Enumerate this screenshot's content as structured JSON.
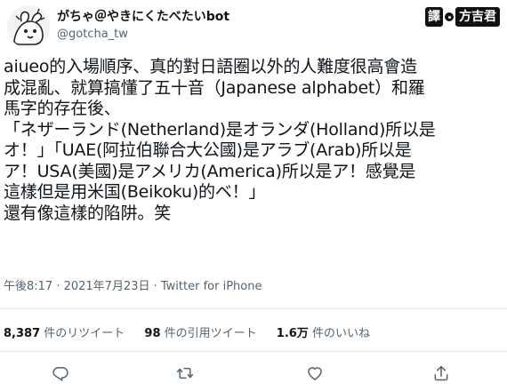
{
  "user": {
    "display_name": "がちゃ＠やきにくたべたいbot",
    "handle": "@gotcha_tw"
  },
  "watermark": {
    "mark": "譯",
    "name": "方吉君"
  },
  "tweet": {
    "lines": [
      "aiueo的入場順序、真的對日語圈以外的人難度很高會造",
      "成混亂、就算搞懂了五十音（Japanese alphabet）和羅",
      "馬字的存在後、",
      "「ネザーランド(Netherland)是オランダ(Holland)所以是",
      "オ！」「UAE(阿拉伯聯合大公國)是アラブ(Arab)所以是",
      "ア！USA(美國)是アメリカ(America)所以是ア！感覺是",
      "這樣但是用米国(Beikoku)的ベ！」",
      "還有像這樣的陷阱。笑"
    ],
    "timestamp": "午後8:17 · 2021年7月23日 · Twitter for iPhone"
  },
  "stats": {
    "retweets_value": "8,387",
    "retweets_label": " 件のリツイート",
    "quotes_value": "98",
    "quotes_label": " 件の引用ツイート",
    "likes_value": "1.6万",
    "likes_label": " 件のいいね"
  },
  "icons": {
    "reply": "reply-icon",
    "retweet": "retweet-icon",
    "like": "heart-icon",
    "share": "share-icon"
  },
  "colors": {
    "text": "#0f1419",
    "secondary": "#536471",
    "divider": "#e3e7ea"
  }
}
